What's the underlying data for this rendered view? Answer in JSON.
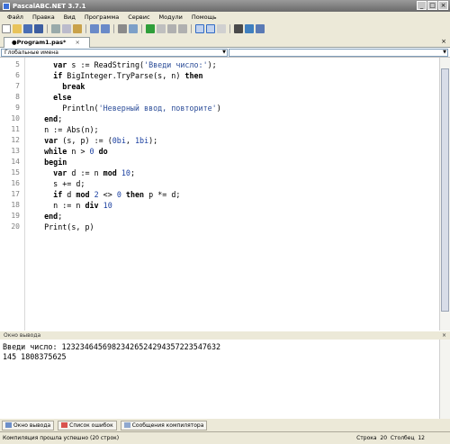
{
  "window": {
    "title": "PascalABC.NET 3.7.1"
  },
  "menu": [
    "Файл",
    "Правка",
    "Вид",
    "Программа",
    "Сервис",
    "Модули",
    "Помощь"
  ],
  "tab": {
    "label": "●Program1.pas*"
  },
  "scope_selector": {
    "value": "Глобальные имена"
  },
  "editor": {
    "line_numbers": [
      "5",
      "6",
      "7",
      "8",
      "9",
      "10",
      "11",
      "12",
      "13",
      "14",
      "15",
      "16",
      "17",
      "18",
      "19",
      "20"
    ],
    "lines": [
      "    var s := ReadString('Введи число:');",
      "    if BigInteger.TryParse(s, n) then",
      "      break",
      "    else",
      "      Println('Неверный ввод, повторите')",
      "  end;",
      "  n := Abs(n);",
      "  var (s, p) := (0bi, 1bi);",
      "  while n > 0 do",
      "  begin",
      "    var d := n mod 10;",
      "    s += d;",
      "    if d mod 2 <> 0 then p *= d;",
      "    n := n div 10",
      "  end;",
      "  Print(s, p)"
    ]
  },
  "output_panel": {
    "header": "Окно вывода",
    "lines": [
      "Введи число: 12323464569823426524294357223547632",
      "145 1808375625"
    ]
  },
  "bottom_tabs": [
    "Окно вывода",
    "Список ошибок",
    "Сообщения компилятора"
  ],
  "status": {
    "message": "Компиляция прошла успешно (20 строк)",
    "row_label": "Строка",
    "row": "20",
    "col_label": "Столбец",
    "col": "12"
  }
}
